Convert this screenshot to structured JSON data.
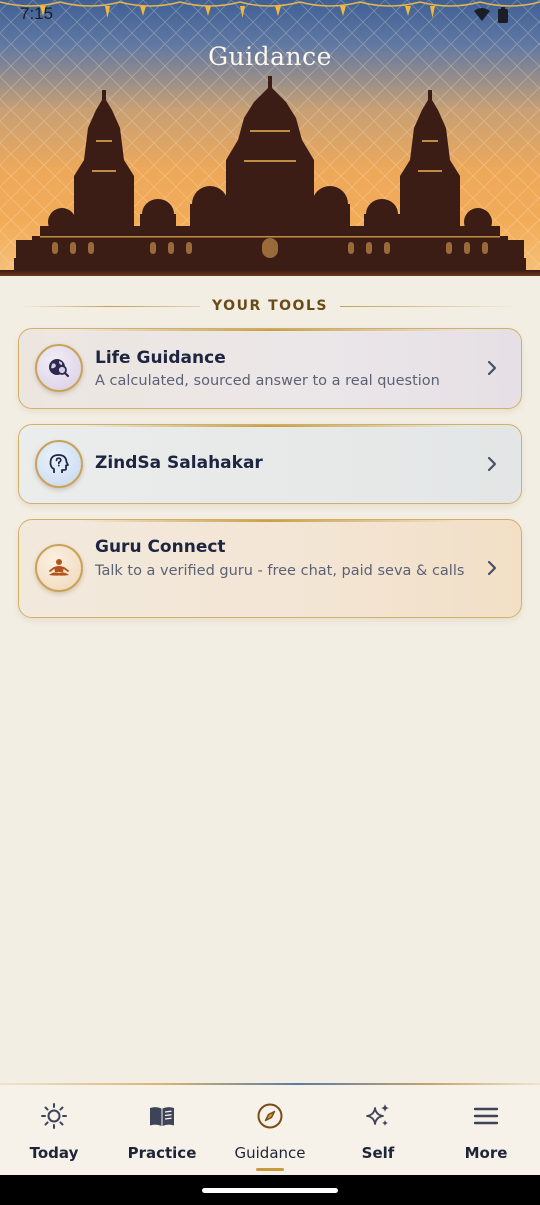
{
  "status_bar": {
    "time": "7:15"
  },
  "header": {
    "title": "Guidance"
  },
  "section": {
    "label": "YOUR TOOLS"
  },
  "tools": [
    {
      "title": "Life Guidance",
      "subtitle": "A calculated, sourced answer to a real question",
      "icon": "globe-search-icon"
    },
    {
      "title": "ZindSa Salahakar",
      "subtitle": "",
      "icon": "head-question-icon"
    },
    {
      "title": "Guru Connect",
      "subtitle": "Talk to a verified guru - free chat, paid seva & calls",
      "icon": "meditation-icon"
    }
  ],
  "nav": {
    "items": [
      {
        "label": "Today",
        "icon": "sun-icon"
      },
      {
        "label": "Practice",
        "icon": "book-icon"
      },
      {
        "label": "Guidance",
        "icon": "compass-icon",
        "active": true
      },
      {
        "label": "Self",
        "icon": "sparkles-icon"
      },
      {
        "label": "More",
        "icon": "menu-icon"
      }
    ]
  },
  "colors": {
    "background": "#f3eee3",
    "accent_gold": "#c99a3c",
    "text_primary": "#1f2538",
    "text_secondary": "#5c6175"
  }
}
